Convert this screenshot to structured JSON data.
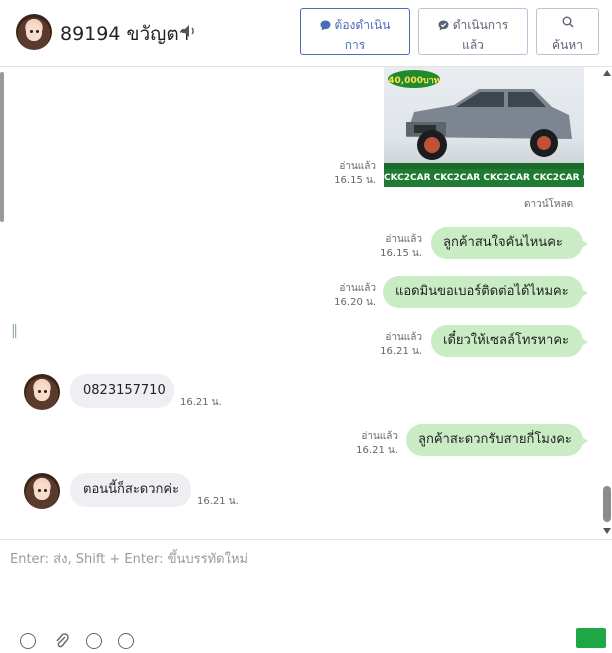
{
  "header": {
    "contact_name": "89194 ขวัญตา",
    "buttons": [
      {
        "line1": "ต้องดำเนิน",
        "line2": "การ",
        "icon": "speech-bubble-icon"
      },
      {
        "line1": "ดำเนินการ",
        "line2": "แล้ว",
        "icon": "check-bubble-icon"
      },
      {
        "line1": "",
        "line2": "ค้นหา",
        "icon": "search-icon"
      }
    ]
  },
  "chat": {
    "image_message": {
      "banner_text": "CKC2CAR CKC2CAR CKC2CAR CKC2CAR CKC2",
      "price_badge": "40,000บาท",
      "read": "อ่านแล้ว",
      "time": "16.15 น.",
      "download": "ดาวน์โหลด"
    },
    "outgoing": [
      {
        "text": "ลูกค้าสนใจคันไหนคะ",
        "read": "อ่านแล้ว",
        "time": "16.15 น."
      },
      {
        "text": "แอดมินขอเบอร์ติดต่อได้ไหมคะ",
        "read": "อ่านแล้ว",
        "time": "16.20 น."
      },
      {
        "text": "เดี๋ยวให้เซลล์โทรหาคะ",
        "read": "อ่านแล้ว",
        "time": "16.21 น."
      },
      {
        "text": "ลูกค้าสะดวกรับสายกี่โมงคะ",
        "read": "อ่านแล้ว",
        "time": "16.21 น."
      }
    ],
    "incoming": [
      {
        "text": "0823157710",
        "time": "16.21 น."
      },
      {
        "text": "ตอนนี้ก็สะดวกค่ะ",
        "time": "16.21 น."
      }
    ]
  },
  "composer": {
    "placeholder": "Enter: ส่ง, Shift + Enter: ขึ้นบรรทัดใหม่",
    "value": ""
  },
  "colors": {
    "outgoing_bubble": "#c9ecc5",
    "incoming_bubble": "#eeeff2",
    "primary_button": "#4a6cb5",
    "send_button": "#1ea744"
  }
}
